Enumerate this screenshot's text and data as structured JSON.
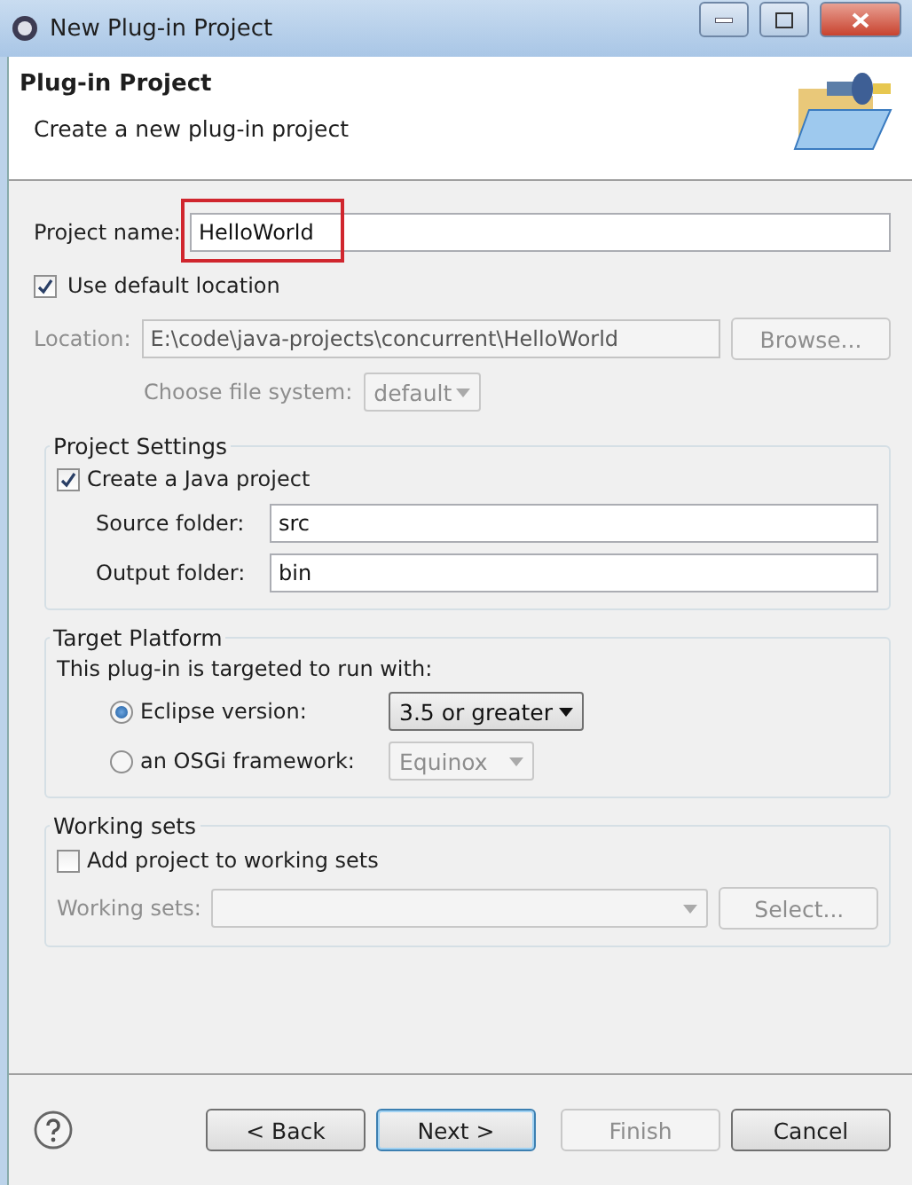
{
  "window": {
    "title": "New Plug-in Project"
  },
  "header": {
    "title": "Plug-in Project",
    "subtitle": "Create a new plug-in project"
  },
  "project_name": {
    "label": "Project name:",
    "value": "HelloWorld",
    "highlighted": true
  },
  "use_default_location": {
    "label": "Use default location",
    "checked": true
  },
  "location": {
    "label": "Location:",
    "value": "E:\\code\\java-projects\\concurrent\\HelloWorld",
    "disabled": true,
    "button": "Browse..."
  },
  "file_system": {
    "label": "Choose file system:",
    "value": "default",
    "disabled": true
  },
  "project_settings": {
    "title": "Project Settings",
    "create_java": {
      "label": "Create a Java project",
      "checked": true
    },
    "fields": [
      {
        "label": "Source folder:",
        "value": "src"
      },
      {
        "label": "Output folder:",
        "value": "bin"
      }
    ]
  },
  "target_platform": {
    "title": "Target Platform",
    "intro": "This plug-in is targeted to run with:",
    "options": [
      {
        "label": "Eclipse version:",
        "selected": true,
        "value": "3.5 or greater"
      },
      {
        "label": "an OSGi framework:",
        "selected": false,
        "value": "Equinox"
      }
    ]
  },
  "working_sets": {
    "title": "Working sets",
    "add": {
      "label": "Add project to working sets",
      "checked": false
    },
    "label": "Working sets:",
    "disabled": true,
    "button": "Select..."
  },
  "buttons": [
    {
      "label": "< Back",
      "disabled": false,
      "default": false
    },
    {
      "label": "Next >",
      "disabled": false,
      "default": true
    },
    {
      "label": "Finish",
      "disabled": true,
      "default": false
    },
    {
      "label": "Cancel",
      "disabled": false,
      "default": false
    }
  ]
}
